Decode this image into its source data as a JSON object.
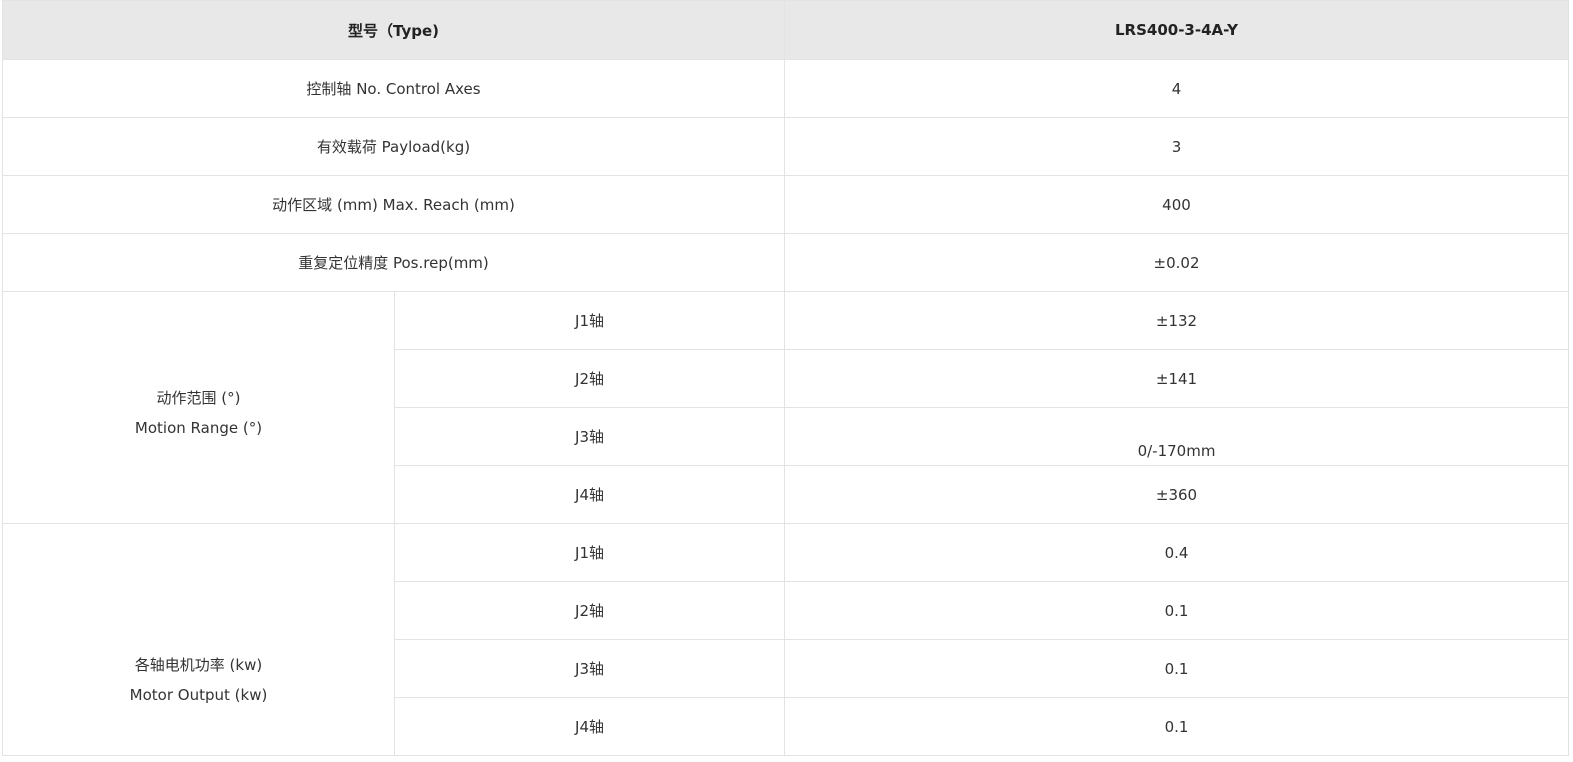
{
  "header": {
    "param_label": "型号（Type)",
    "model": "LRS400-3-4A-Y"
  },
  "rows": [
    {
      "label": "控制轴  No. Control Axes",
      "value": "4"
    },
    {
      "label": "有效载荷  Payload(kg)",
      "value": "3"
    },
    {
      "label": "动作区域 (mm)  Max. Reach (mm)",
      "value": "400"
    },
    {
      "label": "重复定位精度 Pos.rep(mm)",
      "value": "±0.02"
    }
  ],
  "motion_range": {
    "label_cn": "动作范围 (°)",
    "label_en": "Motion Range (°)",
    "axes": [
      {
        "axis": "J1轴",
        "value": "±132"
      },
      {
        "axis": "J2轴",
        "value": "±141"
      },
      {
        "axis": "J3轴",
        "value": "0/-170mm"
      },
      {
        "axis": "J4轴",
        "value": "±360"
      }
    ]
  },
  "motor_output": {
    "label_cn": "各轴电机功率 (kw)",
    "label_en": "Motor Output (kw)",
    "axes": [
      {
        "axis": "J1轴",
        "value": "0.4"
      },
      {
        "axis": "J2轴",
        "value": "0.1"
      },
      {
        "axis": "J3轴",
        "value": "0.1"
      },
      {
        "axis": "J4轴",
        "value": "0.1"
      }
    ]
  }
}
